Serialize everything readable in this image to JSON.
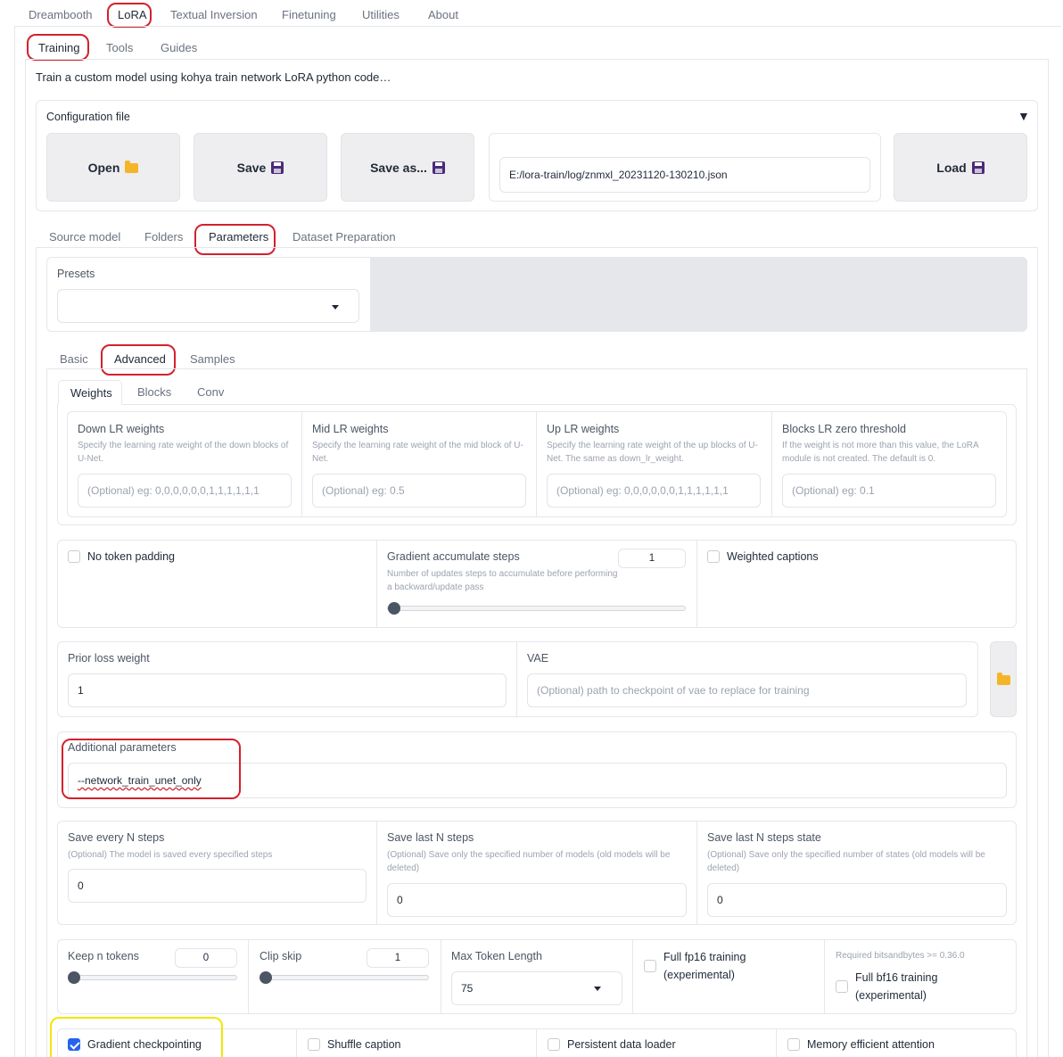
{
  "top_tabs": [
    "Dreambooth",
    "LoRA",
    "Textual Inversion",
    "Finetuning",
    "Utilities",
    "About"
  ],
  "sub_tabs": [
    "Training",
    "Tools",
    "Guides"
  ],
  "description": "Train a custom model using kohya train network LoRA python code…",
  "config": {
    "title": "Configuration file",
    "collapse_glyph": "▼",
    "open_label": "Open",
    "save_label": "Save",
    "save_as_label": "Save as...",
    "file_path": "E:/lora-train/log/znmxl_20231120-130210.json",
    "load_label": "Load"
  },
  "section_tabs": [
    "Source model",
    "Folders",
    "Parameters",
    "Dataset Preparation"
  ],
  "presets": {
    "label": "Presets",
    "value": ""
  },
  "param_tabs": [
    "Basic",
    "Advanced",
    "Samples"
  ],
  "weight_tabs": [
    "Weights",
    "Blocks",
    "Conv"
  ],
  "weights": [
    {
      "label": "Down LR weights",
      "info": "Specify the learning rate weight of the down blocks of U-Net.",
      "placeholder": "(Optional) eg: 0,0,0,0,0,0,1,1,1,1,1,1"
    },
    {
      "label": "Mid LR weights",
      "info": "Specify the learning rate weight of the mid block of U-Net.",
      "placeholder": "(Optional) eg: 0.5"
    },
    {
      "label": "Up LR weights",
      "info": "Specify the learning rate weight of the up blocks of U-Net. The same as down_lr_weight.",
      "placeholder": "(Optional) eg: 0,0,0,0,0,0,1,1,1,1,1,1"
    },
    {
      "label": "Blocks LR zero threshold",
      "info": "If the weight is not more than this value, the LoRA module is not created. The default is 0.",
      "placeholder": "(Optional) eg: 0.1"
    }
  ],
  "no_token_padding": {
    "label": "No token padding",
    "checked": false
  },
  "grad_accum": {
    "label": "Gradient accumulate steps",
    "info": "Number of updates steps to accumulate before performing a backward/update pass",
    "value": "1",
    "slider_fraction": 0
  },
  "weighted_captions": {
    "label": "Weighted captions",
    "checked": false
  },
  "prior_loss": {
    "label": "Prior loss weight",
    "value": "1"
  },
  "vae": {
    "label": "VAE",
    "placeholder": "(Optional) path to checkpoint of vae to replace for training"
  },
  "additional": {
    "label": "Additional parameters",
    "value": "--network_train_unet_only"
  },
  "save_every": {
    "label": "Save every N steps",
    "info": "(Optional) The model is saved every specified steps",
    "value": "0"
  },
  "save_last": {
    "label": "Save last N steps",
    "info": "(Optional) Save only the specified number of models (old models will be deleted)",
    "value": "0"
  },
  "save_last_state": {
    "label": "Save last N steps state",
    "info": "(Optional) Save only the specified number of states (old models will be deleted)",
    "value": "0"
  },
  "keep_tokens": {
    "label": "Keep n tokens",
    "value": "0",
    "slider_fraction": 0
  },
  "clip_skip": {
    "label": "Clip skip",
    "value": "1",
    "slider_fraction": 0
  },
  "max_token": {
    "label": "Max Token Length",
    "value": "75"
  },
  "fp16": {
    "label": "Full fp16 training (experimental)",
    "checked": false
  },
  "bf16": {
    "note": "Required bitsandbytes >= 0.36.0",
    "label": "Full bf16 training (experimental)",
    "checked": false
  },
  "bottom": [
    {
      "label": "Gradient checkpointing",
      "checked": true
    },
    {
      "label": "Shuffle caption",
      "checked": false
    },
    {
      "label": "Persistent data loader",
      "checked": false
    },
    {
      "label": "Memory efficient attention",
      "checked": false
    }
  ],
  "colors": {
    "highlight_red": "#d3212d",
    "highlight_yellow": "#f4e600",
    "checkbox_blue": "#2563eb"
  }
}
